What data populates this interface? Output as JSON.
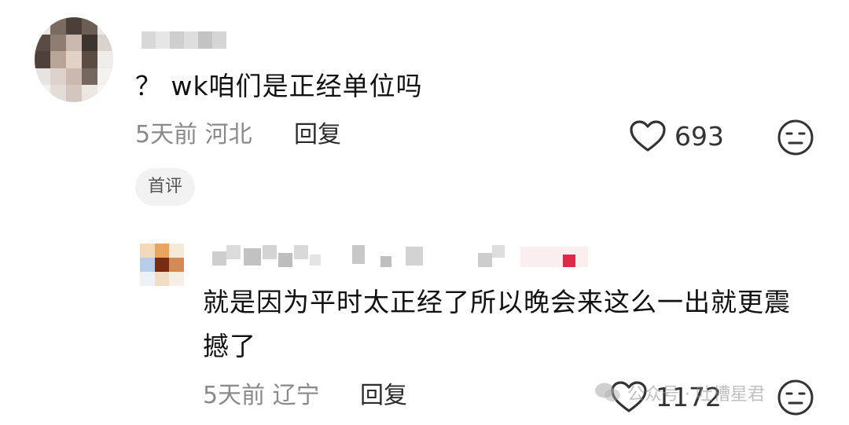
{
  "comments": [
    {
      "text": "？ wk咱们是正经单位吗",
      "meta": "5天前 河北",
      "reply_label": "回复",
      "likes": "693",
      "badge": "首评"
    },
    {
      "text": "就是因为平时太正经了所以晚会来这么一出就更震撼了",
      "meta": "5天前 辽宁",
      "reply_label": "回复",
      "likes": "1172"
    }
  ],
  "watermark": "公众号 · 吐槽星君",
  "icons": {
    "like": "heart-outline-icon",
    "dislike": "neutral-face-icon",
    "watermark": "wechat-icon"
  },
  "colors": {
    "text": "#111111",
    "meta": "#8a8a8a",
    "badge_bg": "#f2f2f2"
  }
}
